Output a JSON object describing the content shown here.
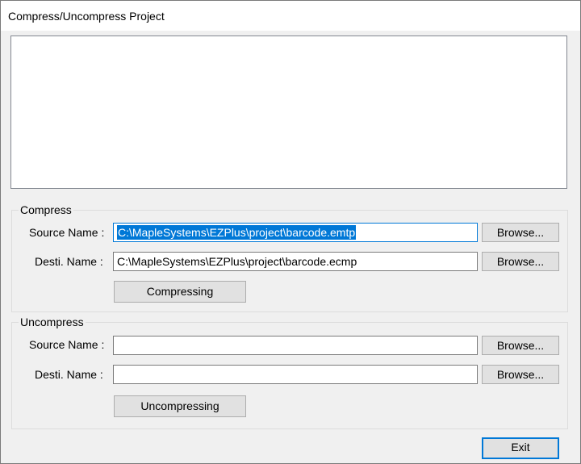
{
  "window": {
    "title": "Compress/Uncompress Project"
  },
  "compress": {
    "group_label": "Compress",
    "source_label": "Source Name :",
    "source_value": "C:\\MapleSystems\\EZPlus\\project\\barcode.emtp",
    "dest_label": "Desti. Name :",
    "dest_value": "C:\\MapleSystems\\EZPlus\\project\\barcode.ecmp",
    "browse_label": "Browse...",
    "action_label": "Compressing"
  },
  "uncompress": {
    "group_label": "Uncompress",
    "source_label": "Source Name :",
    "source_value": "",
    "dest_label": "Desti. Name :",
    "dest_value": "",
    "browse_label": "Browse...",
    "action_label": "Uncompressing"
  },
  "footer": {
    "exit_label": "Exit"
  },
  "colors": {
    "selection": "#0078d7",
    "focus_border": "#0078d7"
  }
}
